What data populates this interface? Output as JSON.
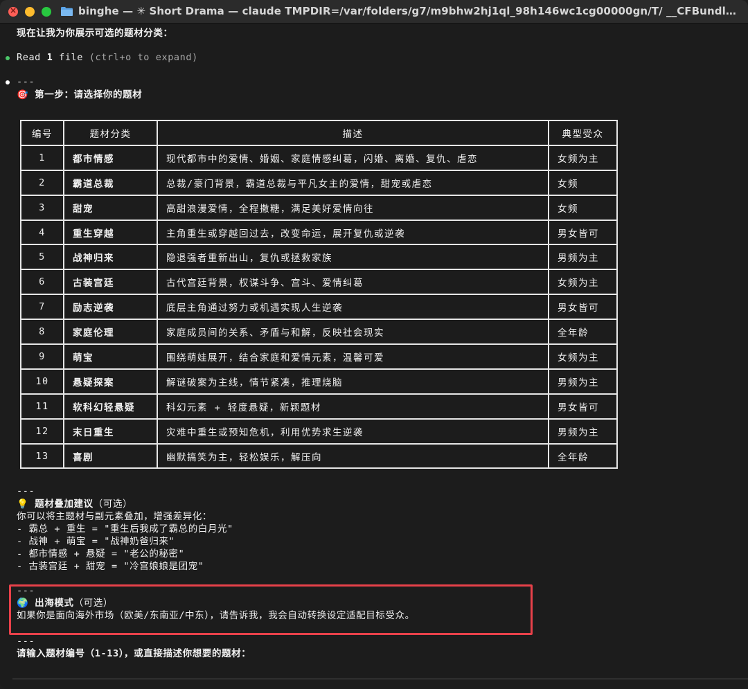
{
  "window": {
    "title": "binghe — ✳ Short Drama — claude TMPDIR=/var/folders/g7/m9bhw2hj1ql_98h146wc1cg00000gn/T/ __CFBundleIden..."
  },
  "terminal": {
    "intro": "现在让我为你展示可选的题材分类：",
    "read_line": {
      "prefix": "Read ",
      "count": "1",
      "suffix": " file",
      "hint": " (ctrl+o to expand)"
    },
    "separator": "---",
    "step_icon": "🎯",
    "step_title": "第一步：请选择你的题材",
    "table": {
      "headers": [
        "编号",
        "题材分类",
        "描述",
        "典型受众"
      ],
      "rows": [
        [
          "1",
          "都市情感",
          "现代都市中的爱情、婚姻、家庭情感纠葛，闪婚、离婚、复仇、虐恋",
          "女频为主"
        ],
        [
          "2",
          "霸道总裁",
          "总裁/豪门背景，霸道总裁与平凡女主的爱情，甜宠或虐恋",
          "女频"
        ],
        [
          "3",
          "甜宠",
          "高甜浪漫爱情，全程撒糖，满足美好爱情向往",
          "女频"
        ],
        [
          "4",
          "重生穿越",
          "主角重生或穿越回过去，改变命运，展开复仇或逆袭",
          "男女皆可"
        ],
        [
          "5",
          "战神归来",
          "隐退强者重新出山，复仇或拯救家族",
          "男频为主"
        ],
        [
          "6",
          "古装宫廷",
          "古代宫廷背景，权谋斗争、宫斗、爱情纠葛",
          "女频为主"
        ],
        [
          "7",
          "励志逆袭",
          "底层主角通过努力或机遇实现人生逆袭",
          "男女皆可"
        ],
        [
          "8",
          "家庭伦理",
          "家庭成员间的关系、矛盾与和解，反映社会现实",
          "全年龄"
        ],
        [
          "9",
          "萌宝",
          "围绕萌娃展开，结合家庭和爱情元素，温馨可爱",
          "女频为主"
        ],
        [
          "10",
          "悬疑探案",
          "解谜破案为主线，情节紧凑，推理烧脑",
          "男频为主"
        ],
        [
          "11",
          "软科幻轻悬疑",
          "科幻元素 + 轻度悬疑，新颖题材",
          "男女皆可"
        ],
        [
          "12",
          "末日重生",
          "灾难中重生或预知危机，利用优势求生逆袭",
          "男频为主"
        ],
        [
          "13",
          "喜剧",
          "幽默搞笑为主，轻松娱乐，解压向",
          "全年龄"
        ]
      ]
    },
    "tip": {
      "icon": "💡",
      "title": "题材叠加建议",
      "title_suffix": "（可选）",
      "body": "你可以将主题材与副元素叠加，增强差异化：",
      "items": [
        "- 霸总 + 重生 = \"重生后我成了霸总的白月光\"",
        "- 战神 + 萌宝 = \"战神奶爸归来\"",
        "- 都市情感 + 悬疑 = \"老公的秘密\"",
        "- 古装宫廷 + 甜宠 = \"冷宫娘娘是团宠\""
      ]
    },
    "overseas": {
      "icon": "🌍",
      "title": "出海模式",
      "title_suffix": "（可选）",
      "body": "如果你是面向海外市场（欧美/东南亚/中东），请告诉我，我会自动转换设定适配目标受众。"
    },
    "prompt": "请输入题材编号（1-13），或直接描述你想要的题材："
  },
  "colors": {
    "background": "#1c1c1c",
    "titlebar": "#2b2b2b",
    "highlight_border": "#e8414a",
    "bullet_green": "#4cc76a"
  }
}
